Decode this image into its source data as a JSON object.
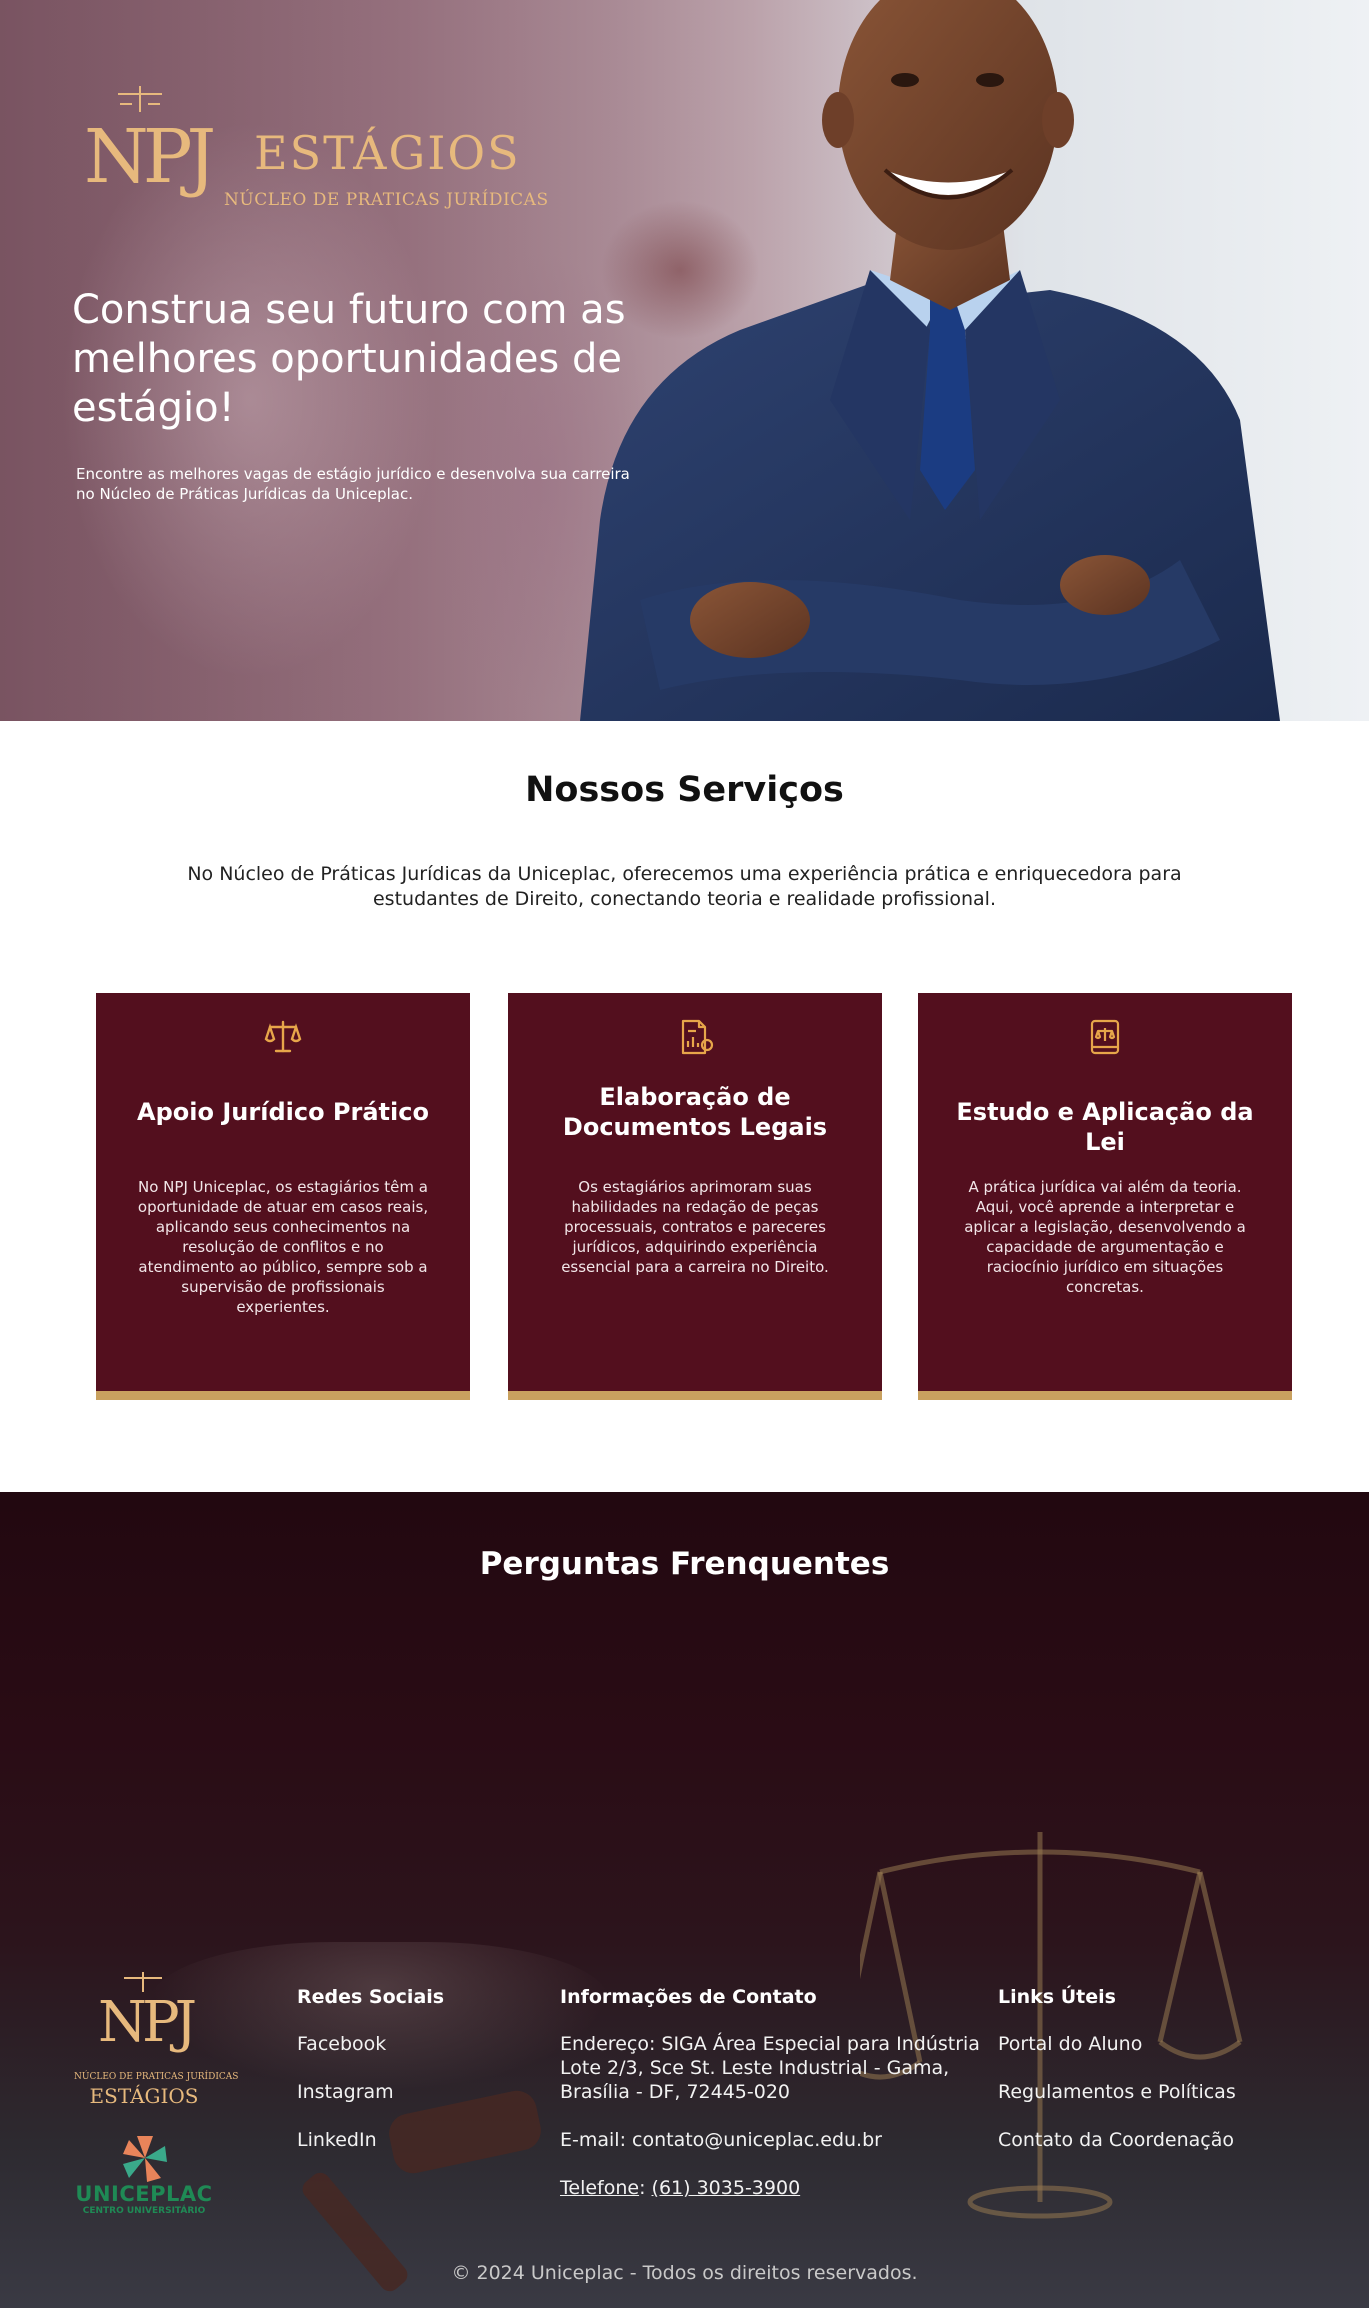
{
  "hero": {
    "logo_mark": "NPJ",
    "logo_title": "ESTÁGIOS",
    "logo_subtitle": "NÚCLEO DE PRATICAS JURÍDICAS",
    "title": "Construa seu futuro com as melhores oportunidades de estágio!",
    "description": "Encontre as melhores vagas de estágio jurídico e desenvolva sua carreira no Núcleo de Práticas Jurídicas da Uniceplac."
  },
  "services": {
    "title": "Nossos Serviços",
    "intro": "No Núcleo de Práticas Jurídicas da Uniceplac, oferecemos uma experiência prática e enriquecedora para estudantes de Direito, conectando teoria e realidade profissional.",
    "cards": [
      {
        "icon": "scale-icon",
        "title": "Apoio Jurídico Prático",
        "description": "No NPJ Uniceplac, os estagiários têm a oportunidade de atuar em casos reais, aplicando seus conhecimentos na resolução de conflitos e no atendimento ao público, sempre sob a supervisão de profissionais experientes."
      },
      {
        "icon": "document-chart-icon",
        "title": "Elaboração de Documentos Legais",
        "description": "Os estagiários aprimoram suas habilidades na redação de peças processuais, contratos e pareceres jurídicos, adquirindo experiência essencial para a carreira no Direito."
      },
      {
        "icon": "law-book-icon",
        "title": "Estudo e Aplicação da Lei",
        "description": "A prática jurídica vai além da teoria. Aqui, você aprende a interpretar e aplicar a legislação, desenvolvendo a capacidade de argumentação e raciocínio jurídico em situações concretas."
      }
    ]
  },
  "faq": {
    "title": "Perguntas Frenquentes"
  },
  "footer": {
    "logo_mark": "NPJ",
    "logo_subtitle": "NÚCLEO DE PRATICAS JURÍDICAS",
    "logo_title": "ESTÁGIOS",
    "uniceplac_name": "UNICEPLAC",
    "uniceplac_sub": "CENTRO UNIVERSITÁRIO",
    "social": {
      "heading": "Redes Sociais",
      "links": [
        "Facebook",
        "Instagram",
        "LinkedIn"
      ]
    },
    "contact": {
      "heading": "Informações de Contato",
      "address": "Endereço: SIGA Área Especial para Indústria Lote 2/3, Sce St. Leste Industrial - Gama, Brasília - DF, 72445-020",
      "email": "E-mail: contato@uniceplac.edu.br",
      "phone_label": "Telefone",
      "phone_sep": ": ",
      "phone_number": "(61) 3035-3900"
    },
    "useful": {
      "heading": "Links Úteis",
      "links": [
        "Portal do Aluno",
        "Regulamentos e Políticas",
        "Contato da Coordenação"
      ]
    },
    "copyright": "© 2024 Uniceplac - Todos os direitos reservados."
  },
  "colors": {
    "card_bg": "#530f1e",
    "gold": "#c9a15f",
    "logo_gold": "#e7b97d",
    "footer_dark": "#220810",
    "uniceplac_green": "#1f8a55"
  }
}
